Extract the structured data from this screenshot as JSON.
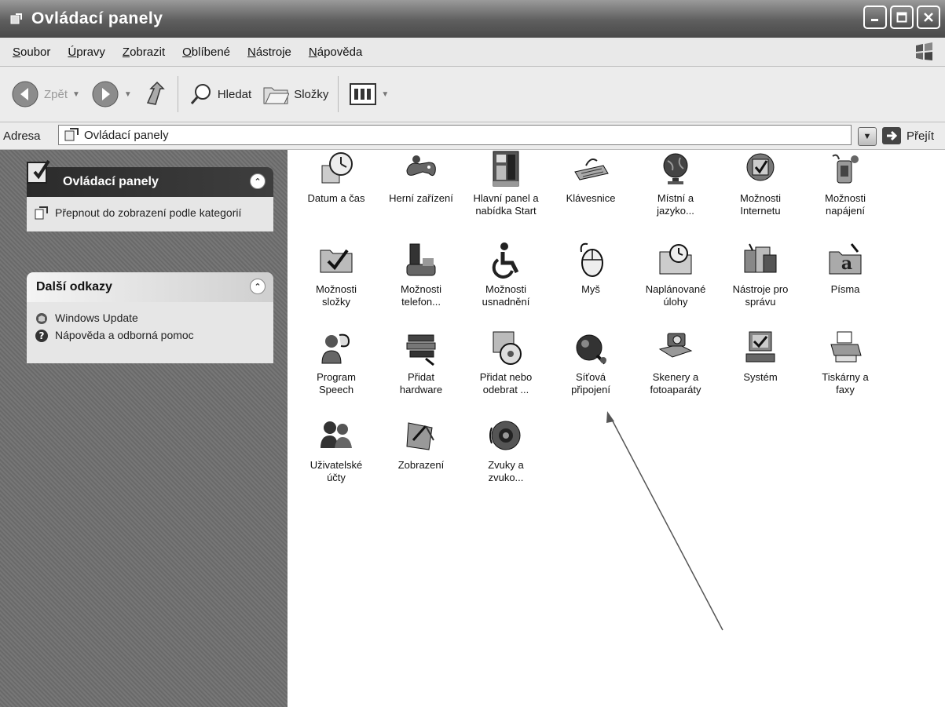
{
  "window": {
    "title": "Ovládací panely"
  },
  "menu": [
    "Soubor",
    "Úpravy",
    "Zobrazit",
    "Oblíbené",
    "Nástroje",
    "Nápověda"
  ],
  "toolbar": {
    "back": "Zpět",
    "search": "Hledat",
    "folders": "Složky"
  },
  "address": {
    "label": "Adresa",
    "value": "Ovládací panely",
    "go": "Přejít"
  },
  "taskpane": {
    "panel1": {
      "title": "Ovládací panely",
      "link": "Přepnout do zobrazení podle kategorií"
    },
    "panel2": {
      "title": "Další odkazy",
      "links": [
        "Windows Update",
        "Nápověda a odborná pomoc"
      ]
    }
  },
  "items": [
    {
      "line1": "Datum a čas",
      "line2": "",
      "icon": "clock-icon"
    },
    {
      "line1": "Herní zařízení",
      "line2": "",
      "icon": "gamepad-icon"
    },
    {
      "line1": "Hlavní panel a",
      "line2": "nabídka Start",
      "icon": "taskbar-icon"
    },
    {
      "line1": "Klávesnice",
      "line2": "",
      "icon": "keyboard-icon"
    },
    {
      "line1": "Místní a",
      "line2": "jazyko...",
      "icon": "globe-icon"
    },
    {
      "line1": "Možnosti",
      "line2": "Internetu",
      "icon": "internet-globe-icon"
    },
    {
      "line1": "Možnosti",
      "line2": "napájení",
      "icon": "power-icon"
    },
    {
      "line1": "Možnosti",
      "line2": "složky",
      "icon": "folder-check-icon"
    },
    {
      "line1": "Možnosti",
      "line2": "telefon...",
      "icon": "phone-icon"
    },
    {
      "line1": "Možnosti",
      "line2": "usnadnění",
      "icon": "accessibility-icon"
    },
    {
      "line1": "Myš",
      "line2": "",
      "icon": "mouse-icon"
    },
    {
      "line1": "Naplánované",
      "line2": "úlohy",
      "icon": "scheduled-folder-icon"
    },
    {
      "line1": "Nástroje pro",
      "line2": "správu",
      "icon": "admin-tools-icon"
    },
    {
      "line1": "Písma",
      "line2": "",
      "icon": "fonts-folder-icon"
    },
    {
      "line1": "Program",
      "line2": "Speech",
      "icon": "speech-icon"
    },
    {
      "line1": "Přidat",
      "line2": "hardware",
      "icon": "hardware-icon"
    },
    {
      "line1": "Přidat nebo",
      "line2": "odebrat ...",
      "icon": "add-remove-icon"
    },
    {
      "line1": "Síťová",
      "line2": "připojení",
      "icon": "network-icon"
    },
    {
      "line1": "Skenery a",
      "line2": "fotoaparáty",
      "icon": "scanner-icon"
    },
    {
      "line1": "Systém",
      "line2": "",
      "icon": "system-icon"
    },
    {
      "line1": "Tiskárny a",
      "line2": "faxy",
      "icon": "printer-icon"
    },
    {
      "line1": "Uživatelské",
      "line2": "účty",
      "icon": "users-icon"
    },
    {
      "line1": "Zobrazení",
      "line2": "",
      "icon": "display-icon"
    },
    {
      "line1": "Zvuky a",
      "line2": "zvuko...",
      "icon": "speaker-icon"
    }
  ]
}
